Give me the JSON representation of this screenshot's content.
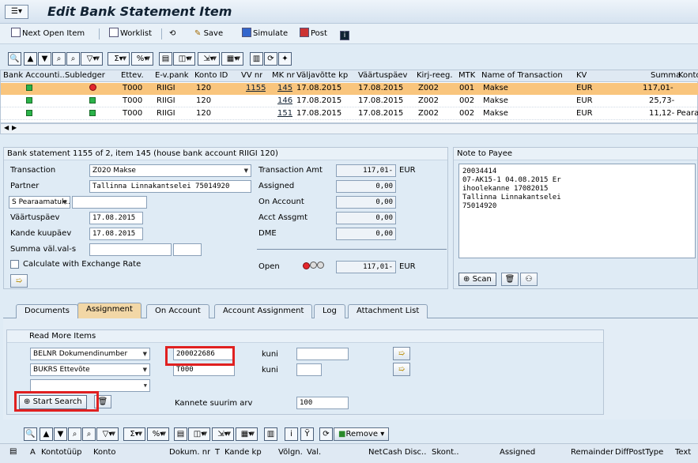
{
  "title": "Edit Bank Statement Item",
  "toolbar": {
    "next_open": "Next Open Item",
    "worklist": "Worklist",
    "save": "Save",
    "simulate": "Simulate",
    "post": "Post"
  },
  "grid": {
    "headers": [
      "Bank Accounti..",
      "Subledger",
      "Ettev.",
      "E-v.pank",
      "Konto ID",
      "VV nr",
      "MK nr",
      "Väljavõtte kp",
      "Väärtuspäev",
      "Kirj-reeg.",
      "MTK",
      "Name of Transaction",
      "KV",
      "Summa",
      "Konto"
    ],
    "rows": [
      {
        "status": "green",
        "sub": "red",
        "ettev": "T000",
        "evpank": "RIIGI",
        "konto": "120",
        "vv": "1155",
        "mk": "145",
        "vkp": "17.08.2015",
        "vp": "17.08.2015",
        "kr": "Z002",
        "mtk": "001",
        "name": "Makse",
        "kv": "EUR",
        "summa": "117,01-",
        "konto2": ""
      },
      {
        "status": "green",
        "sub": "green",
        "ettev": "T000",
        "evpank": "RIIGI",
        "konto": "120",
        "vv": "",
        "mk": "146",
        "vkp": "17.08.2015",
        "vp": "17.08.2015",
        "kr": "Z002",
        "mtk": "002",
        "name": "Makse",
        "kv": "EUR",
        "summa": "25,73-",
        "konto2": ""
      },
      {
        "status": "green",
        "sub": "green",
        "ettev": "T000",
        "evpank": "RIIGI",
        "konto": "120",
        "vv": "",
        "mk": "151",
        "vkp": "17.08.2015",
        "vp": "17.08.2015",
        "kr": "Z002",
        "mtk": "002",
        "name": "Makse",
        "kv": "EUR",
        "summa": "11,12-",
        "konto2": "Peara"
      }
    ]
  },
  "main": {
    "header": "Bank statement 1155 of 2, item 145 (house bank account RIIGI 120)",
    "transaction_label": "Transaction",
    "transaction_value": "Z020 Makse",
    "partner_label": "Partner",
    "partner_value": "Tallinna Linnakantselei 75014920",
    "peara_value": "S Pearaamatuk..",
    "vaartus_label": "Väärtuspäev",
    "vaartus_value": "17.08.2015",
    "kande_label": "Kande kuupäev",
    "kande_value": "17.08.2015",
    "summa_label": "Summa väl.val-s",
    "calc_label": "Calculate with Exchange Rate",
    "amounts": [
      {
        "label": "Transaction Amt",
        "value": "117,01-",
        "cur": "EUR"
      },
      {
        "label": "Assigned",
        "value": "0,00",
        "cur": ""
      },
      {
        "label": "On Account",
        "value": "0,00",
        "cur": ""
      },
      {
        "label": "Acct Assgmt",
        "value": "0,00",
        "cur": ""
      },
      {
        "label": "DME",
        "value": "0,00",
        "cur": ""
      }
    ],
    "open_label": "Open",
    "open_value": "117,01-",
    "open_cur": "EUR"
  },
  "note": {
    "header": "Note to Payee",
    "text": "20034414\n07-AK15-1 04.08.2015 Er\nihoolekanne 17082015\nTallinna Linnakantselei\n75014920",
    "scan": "Scan"
  },
  "tabs": [
    "Documents",
    "Assignment",
    "On Account",
    "Account Assignment",
    "Log",
    "Attachment List"
  ],
  "read_more": {
    "title": "Read More Items",
    "rows": [
      {
        "field": "BELNR Dokumendinumber",
        "value": "200022686",
        "kuni": "kuni"
      },
      {
        "field": "BUKRS Ettevõte",
        "value": "T000",
        "kuni": "kuni"
      }
    ],
    "start_search": "Start Search",
    "max_label": "Kannete suurim arv",
    "max_value": "100"
  },
  "toolbar3": {
    "remove": "Remove"
  },
  "grid2_headers": [
    "A",
    "Kontotüüp",
    "Konto",
    "Dokum. nr",
    "T",
    "Kande kp",
    "Võlgn.",
    "Val.",
    "Net",
    "Cash Disc..",
    "Skont..",
    "Assigned",
    "Remainder",
    "DiffPostType",
    "Text"
  ],
  "colors": {
    "selected_row": "#f9c57d",
    "highlight": "#e02020",
    "active_tab": "#f2d7a6"
  }
}
